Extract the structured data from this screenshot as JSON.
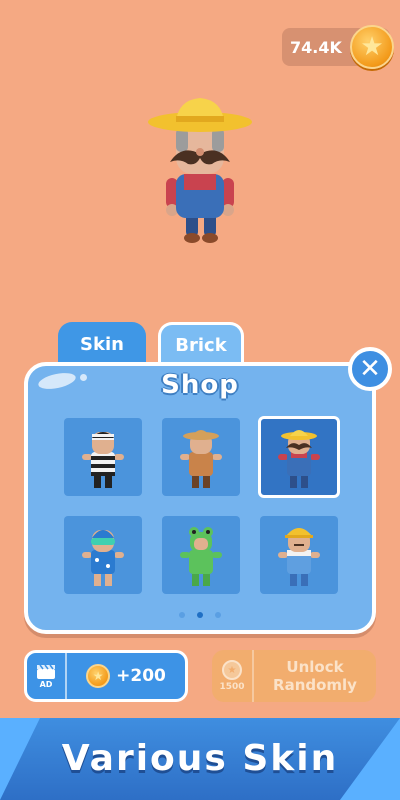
{
  "header": {
    "coins": "74.4K",
    "coin_icon": "star-coin-icon"
  },
  "tabs": [
    {
      "label": "Skin",
      "active": true
    },
    {
      "label": "Brick",
      "active": false
    }
  ],
  "shop": {
    "title": "Shop",
    "close_icon": "close-icon",
    "items": [
      {
        "name": "prisoner-skin",
        "selected": false
      },
      {
        "name": "farmer-skin",
        "selected": false
      },
      {
        "name": "mustache-farmer-skin",
        "selected": true
      },
      {
        "name": "swimmer-skin",
        "selected": false
      },
      {
        "name": "frog-skin",
        "selected": false
      },
      {
        "name": "builder-skin",
        "selected": false
      }
    ],
    "page_dots": 3,
    "active_page": 1
  },
  "buttons": {
    "ad_label": "AD",
    "ad_reward": "+200",
    "unlock_cost": "1500",
    "unlock_label_line1": "Unlock",
    "unlock_label_line2": "Randomly"
  },
  "banner": {
    "text": "Various Skin"
  },
  "colors": {
    "background": "#f5a983",
    "panel": "#74b3ee",
    "accent": "#3f97e6",
    "coin": "#f39a1a"
  }
}
